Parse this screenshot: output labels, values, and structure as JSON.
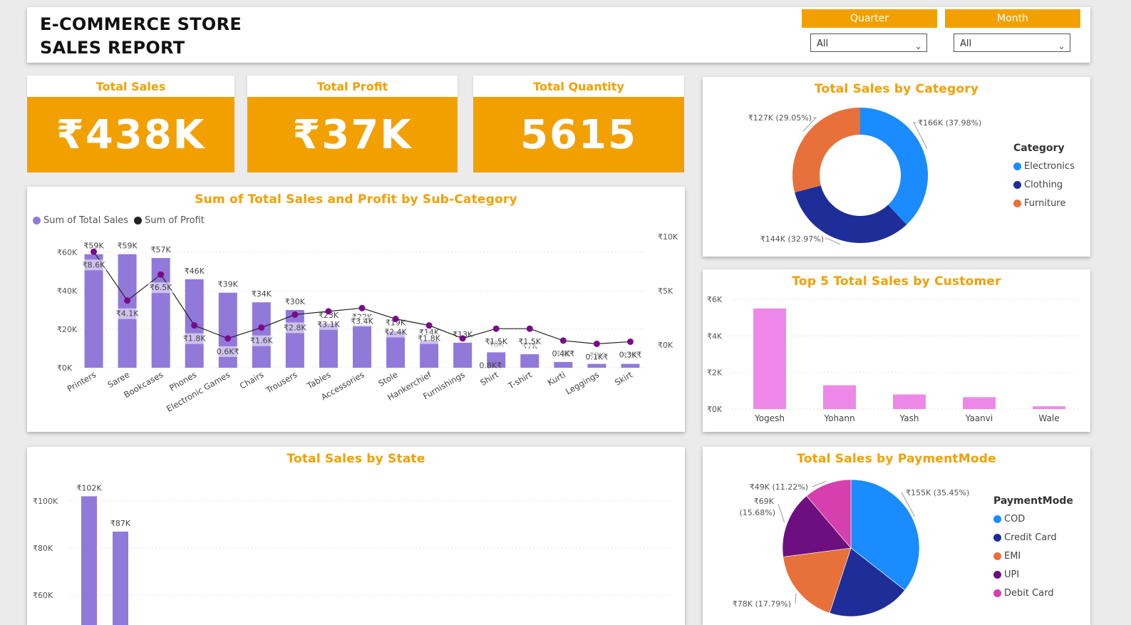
{
  "header": {
    "title_line1": "E-COMMERCE STORE",
    "title_line2": "SALES REPORT",
    "slicers": [
      {
        "label": "Quarter",
        "value": "All"
      },
      {
        "label": "Month",
        "value": "All"
      }
    ]
  },
  "kpis": {
    "sales": {
      "label": "Total Sales",
      "value": "₹438K"
    },
    "profit": {
      "label": "Total Profit",
      "value": "₹37K"
    },
    "quantity": {
      "label": "Total Quantity",
      "value": "5615"
    }
  },
  "colors": {
    "accent": "#f2a000",
    "bar_purple": "#9179d9",
    "line_dark": "#222222",
    "pink": "#ee88e8",
    "electronics": "#1a8cff",
    "clothing": "#1f2d99",
    "furniture": "#e8703a",
    "upi": "#6e0f80",
    "debit_card": "#d63fae"
  },
  "chart_data": [
    {
      "id": "subcategory",
      "type": "bar",
      "title": "Sum of Total Sales and Profit by Sub-Category",
      "legend": [
        "Sum of Total Sales",
        "Sum of Profit"
      ],
      "categories": [
        "Printers",
        "Saree",
        "Bookcases",
        "Phones",
        "Electronic Games",
        "Chairs",
        "Trousers",
        "Tables",
        "Accessories",
        "Stole",
        "Hankerchief",
        "Furnishings",
        "Shirt",
        "T-shirt",
        "Kurti",
        "Leggings",
        "Skirt"
      ],
      "series": [
        {
          "name": "Sum of Total Sales",
          "values": [
            59000,
            59000,
            57000,
            46000,
            39000,
            34000,
            30000,
            23000,
            22000,
            19000,
            14000,
            13000,
            8000,
            7000,
            3000,
            2000,
            2000
          ],
          "labels": [
            "₹59K",
            "₹59K",
            "₹57K",
            "₹46K",
            "₹39K",
            "₹34K",
            "₹30K",
            "₹23K",
            "₹22K",
            "₹19K",
            "₹14K",
            "₹13K",
            "₹8K",
            "₹7K",
            "₹3K",
            "₹2K",
            "₹2K"
          ]
        },
        {
          "name": "Sum of Profit",
          "values": [
            8600,
            4100,
            6500,
            1800,
            600,
            1600,
            2800,
            3100,
            3400,
            2400,
            1800,
            600,
            1500,
            1500,
            400,
            100,
            300
          ],
          "labels": [
            "₹8.6K",
            "₹4.1K",
            "₹6.5K",
            "₹1.8K",
            "0.6K₹",
            "₹1.6K",
            "₹2.8K",
            "₹3.1K",
            "₹3.4K",
            "₹2.4K",
            "₹1.8K",
            "",
            "₹1.5K",
            "₹1.5K",
            "0.4K₹",
            "0.1K₹",
            "0.3K₹"
          ]
        }
      ],
      "extra_label": "0.8K₹",
      "y_ticks": [
        "₹0K",
        "₹20K",
        "₹40K",
        "₹60K"
      ],
      "y2_ticks": [
        "₹0K",
        "₹5K",
        "₹10K"
      ],
      "ylim": [
        0,
        60000
      ],
      "y2lim": [
        -5000,
        10000
      ]
    },
    {
      "id": "category",
      "type": "pie",
      "title": "Total Sales by Category",
      "legend_title": "Category",
      "categories": [
        "Electronics",
        "Clothing",
        "Furniture"
      ],
      "values": [
        166000,
        144000,
        127000
      ],
      "labels": [
        "₹166K (37.98%)",
        "₹144K (32.97%)",
        "₹127K (29.05%)"
      ]
    },
    {
      "id": "customers",
      "type": "bar",
      "title": "Top 5 Total Sales by Customer",
      "categories": [
        "Yogesh",
        "Yohann",
        "Yash",
        "Yaanvi",
        "Wale"
      ],
      "values": [
        5500,
        1300,
        800,
        650,
        150
      ],
      "y_ticks": [
        "₹0K",
        "₹2K",
        "₹4K",
        "₹6K"
      ],
      "ylim": [
        0,
        6000
      ]
    },
    {
      "id": "state",
      "type": "bar",
      "title": "Total Sales by State",
      "values": [
        102000,
        87000
      ],
      "labels": [
        "₹102K",
        "₹87K"
      ],
      "y_ticks": [
        "₹60K",
        "₹80K",
        "₹100K"
      ]
    },
    {
      "id": "payment",
      "type": "pie",
      "title": "Total Sales by PaymentMode",
      "legend_title": "PaymentMode",
      "categories": [
        "COD",
        "Credit Card",
        "EMI",
        "UPI",
        "Debit Card"
      ],
      "values": [
        155000,
        85000,
        78000,
        69000,
        49000
      ],
      "labels": [
        "₹155K (35.45%)",
        "",
        "₹78K (17.79%)",
        "₹69K (15.68%)",
        "₹49K (11.22%)"
      ]
    }
  ]
}
